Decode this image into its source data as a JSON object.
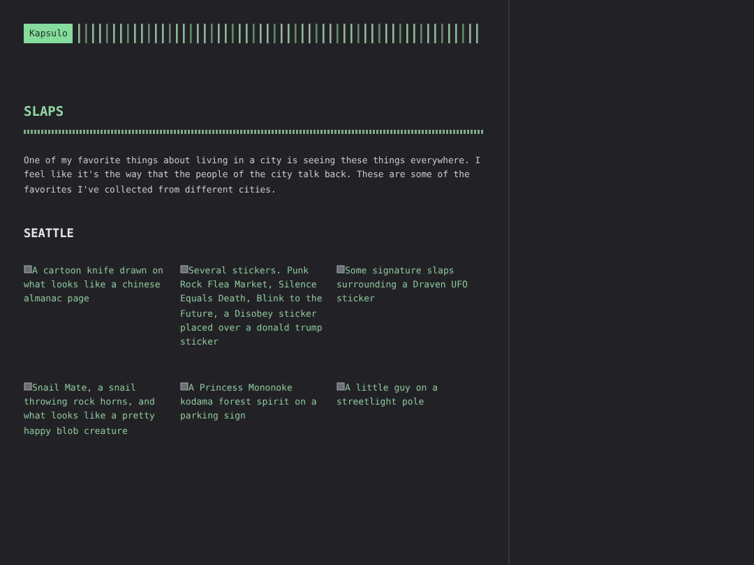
{
  "logo": "Kapsulo",
  "title": "SLAPS",
  "intro": "One of my favorite things about living in a city is seeing these things everywhere. I feel like it's the way that the people of the city talk back. These are some of the favorites I've collected from different cities.",
  "sections": [
    {
      "city": "SEATTLE",
      "images": [
        {
          "alt": "A cartoon knife drawn on what looks like a chinese almanac page"
        },
        {
          "alt": "Several stickers. Punk Rock Flea Market, Silence Equals Death, Blink to the Future, a Disobey sticker placed over a donald trump sticker"
        },
        {
          "alt": "Some signature slaps surrounding a Draven UFO sticker"
        },
        {
          "alt": "Snail Mate, a snail throwing rock horns, and what looks like a pretty happy blob creature"
        },
        {
          "alt": "A Princess Mononoke kodama forest spirit on a parking sign"
        },
        {
          "alt": "A little guy on a streetlight pole"
        }
      ]
    }
  ]
}
